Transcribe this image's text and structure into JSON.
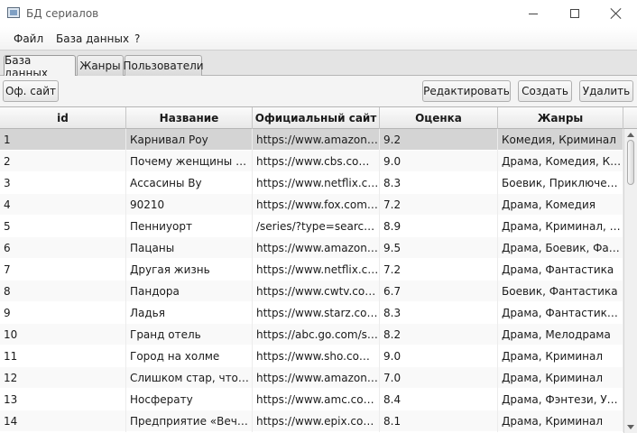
{
  "window": {
    "title": "БД сериалов",
    "icon": "app-icon"
  },
  "menu": {
    "file": "Файл",
    "database": "База данных",
    "help": "?"
  },
  "tabs": [
    {
      "label": "База данных",
      "active": true
    },
    {
      "label": "Жанры",
      "active": false
    },
    {
      "label": "Пользователи",
      "active": false
    }
  ],
  "toolbar": {
    "official_site": "Оф. сайт",
    "edit": "Редактировать",
    "create": "Создать",
    "delete": "Удалить"
  },
  "table": {
    "columns": [
      "id",
      "Название",
      "Официальный сайт",
      "Оценка",
      "Жанры"
    ],
    "selected_row": 0,
    "rows": [
      {
        "id": "1",
        "name": "Карнивал Роу",
        "site": "https://www.amazon.co...",
        "rating": "9.2",
        "genres": "Комедия, Криминал"
      },
      {
        "id": "2",
        "name": "Почему женщины уби...",
        "site": "https://www.cbs.com/s...",
        "rating": "9.0",
        "genres": "Драма, Комедия, Кри..."
      },
      {
        "id": "3",
        "name": "Ассасины Ву",
        "site": "https://www.netflix.co...",
        "rating": "8.3",
        "genres": "Боевик, Приключенче..."
      },
      {
        "id": "4",
        "name": "90210",
        "site": "https://www.fox.com/b...",
        "rating": "7.2",
        "genres": "Драма, Комедия"
      },
      {
        "id": "5",
        "name": "Пенниуорт",
        "site": "/series/?type=search&r...",
        "rating": "8.9",
        "genres": "Драма, Криминал, Бое..."
      },
      {
        "id": "6",
        "name": "Пацаны",
        "site": "https://www.amazon.co...",
        "rating": "9.5",
        "genres": "Драма, Боевик, Фанта..."
      },
      {
        "id": "7",
        "name": "Другая жизнь",
        "site": "https://www.netflix.co...",
        "rating": "7.2",
        "genres": "Драма, Фантастика"
      },
      {
        "id": "8",
        "name": "Пандора",
        "site": "https://www.cwtv.com/...",
        "rating": "6.7",
        "genres": "Боевик, Фантастика"
      },
      {
        "id": "9",
        "name": "Ладья",
        "site": "https://www.starz.com/...",
        "rating": "8.3",
        "genres": "Драма, Фантастика, Тр..."
      },
      {
        "id": "10",
        "name": "Гранд отель",
        "site": "https://abc.go.com/sho...",
        "rating": "8.2",
        "genres": "Драма, Мелодрама"
      },
      {
        "id": "11",
        "name": "Город на холме",
        "site": "https://www.sho.com/ci...",
        "rating": "9.0",
        "genres": "Драма, Криминал"
      },
      {
        "id": "12",
        "name": "Слишком стар, чтобы ...",
        "site": "https://www.amazon.co...",
        "rating": "7.0",
        "genres": "Драма, Криминал"
      },
      {
        "id": "13",
        "name": "Носферату",
        "site": "https://www.amc.com/s...",
        "rating": "8.4",
        "genres": "Драма, Фэнтези, Ужас..."
      },
      {
        "id": "14",
        "name": "Предприятие «Вечная...",
        "site": "https://www.epix.com/s...",
        "rating": "8.1",
        "genres": "Драма, Криминал"
      }
    ]
  }
}
